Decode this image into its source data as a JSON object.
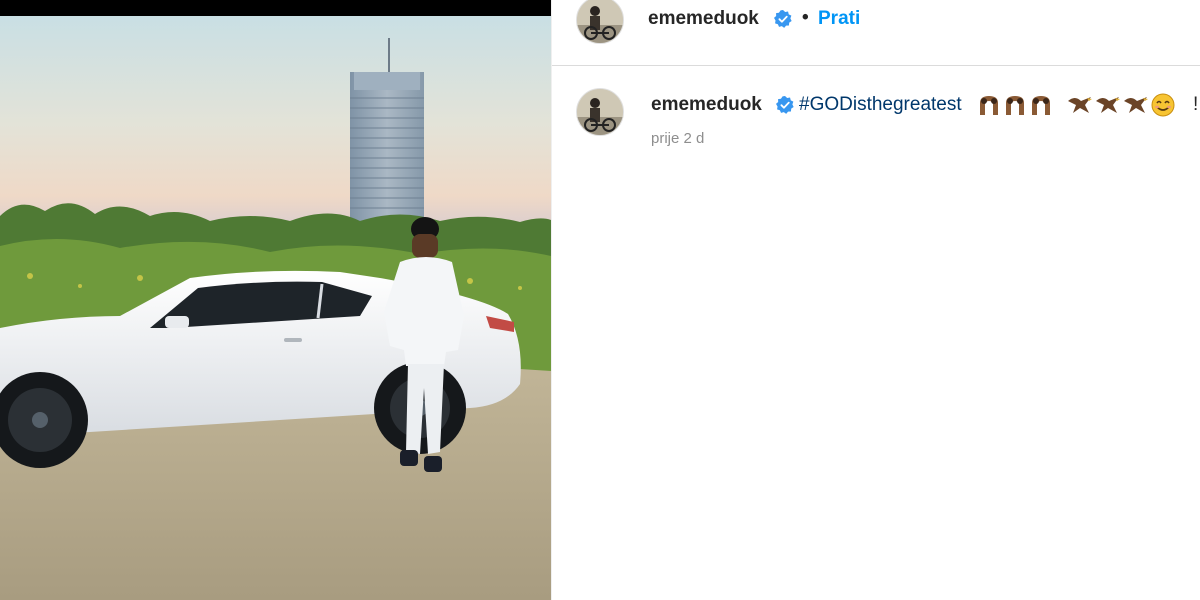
{
  "post": {
    "username": "ememeduok",
    "follow_label": "Prati",
    "separator": "•",
    "caption_hashtag": "#GODisthegreatest",
    "caption_trailing": "!",
    "timestamp": "prije 2 d",
    "caption_emojis": [
      "arch-icon",
      "arch-icon",
      "arch-icon",
      "eagle-icon",
      "eagle-icon",
      "eagle-icon",
      "smiling-face-icon"
    ]
  },
  "colors": {
    "link_blue": "#0095f6",
    "hashtag_blue": "#00376b",
    "verified_blue": "#3897f0",
    "muted_gray": "#8e8e8e"
  }
}
